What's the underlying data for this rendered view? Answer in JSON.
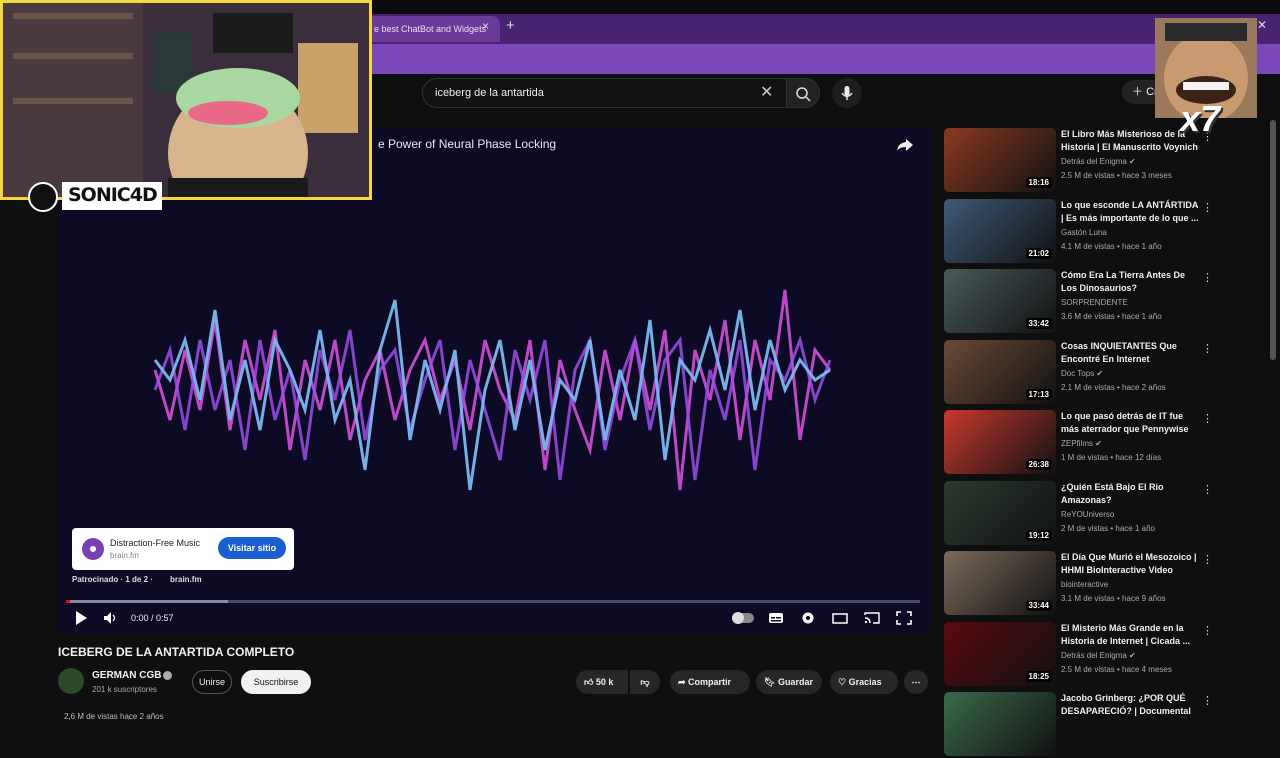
{
  "browser": {
    "active_tab_title": "e best ChatBot and Widgets",
    "close_glyph": "×",
    "new_tab_glyph": "+"
  },
  "header": {
    "search_value": "iceberg de la antartida",
    "create_label": "Cr"
  },
  "player": {
    "overlay_title": "e Power of Neural Phase Locking",
    "progress_played_fraction": 0.0,
    "progress_buffered_fraction": 0.19,
    "time": "0:00 / 0:57",
    "ad": {
      "title": "Distraction-Free Music",
      "domain": "brain.fm",
      "cta": "Visitar sitio",
      "sponsored": "Patrocinado · 1 de 2 ·",
      "sponsored_domain": "brain.fm"
    }
  },
  "video": {
    "title": "ICEBERG DE LA ANTARTIDA COMPLETO",
    "channel": "GERMAN CGB",
    "subscribers": "201 k suscriptores",
    "join_label": "Unirse",
    "subscribe_label": "Suscribirse",
    "likes": "50 k",
    "share_label": "Compartir",
    "save_label": "Guardar",
    "thanks_label": "Gracias",
    "views_partial": "2,6 M de vistas  hace 2 años"
  },
  "recommendations": [
    {
      "title": "El Libro Más Misterioso de la Historia | El Manuscrito Voynich",
      "channel": "Detrás del Enigma",
      "meta": "2.5 M de vistas • hace 3 meses",
      "duration": "18:16",
      "thumb": "#8a3a20",
      "verified": true
    },
    {
      "title": "Lo que esconde LA ANTÁRTIDA | Es más importante de lo que ...",
      "channel": "Gastón Luna",
      "meta": "4.1 M de vistas • hace 1 año",
      "duration": "21:02",
      "thumb": "#3e5a78",
      "verified": false
    },
    {
      "title": "Cómo Era La Tierra Antes De Los Dinosaurios?",
      "channel": "SORPRENDENTE",
      "meta": "3.6 M de vistas • hace 1 año",
      "duration": "33:42",
      "thumb": "#4a5a5c",
      "verified": false
    },
    {
      "title": "Cosas INQUIETANTES Que Encontré En Internet",
      "channel": "Doc Tops",
      "meta": "2.1 M de vistas • hace 2 años",
      "duration": "17:13",
      "thumb": "#6a4a36",
      "verified": true
    },
    {
      "title": "Lo que pasó detrás de IT fue más aterrador que Pennywise",
      "channel": "ZEPfilms",
      "meta": "1 M de vistas • hace 12 días",
      "duration": "26:38",
      "thumb": "#c8382e",
      "verified": true
    },
    {
      "title": "¿Quién Está Bajo El Rio Amazonas?",
      "channel": "ReYOUniverso",
      "meta": "2 M de vistas • hace 1 año",
      "duration": "19:12",
      "thumb": "#2a3a30",
      "verified": false
    },
    {
      "title": "El Día Que Murió el Mesozoico | HHMI BioInteractive Video",
      "channel": "biointeractive",
      "meta": "3.1 M de vistas • hace 9 años",
      "duration": "33:44",
      "thumb": "#7a6a5a",
      "verified": false
    },
    {
      "title": "El Misterio Más Grande en la Historia de Internet | Cicada ...",
      "channel": "Detrás del Enigma",
      "meta": "2.5 M de vistas • hace 4 meses",
      "duration": "18:25",
      "thumb": "#5a0a10",
      "verified": true
    },
    {
      "title": "Jacobo Grinberg: ¿POR QUÉ DESAPARECIÓ? | Documental",
      "channel": "",
      "meta": "",
      "duration": "",
      "thumb": "#3a6a4a",
      "verified": false
    }
  ],
  "overlays": {
    "streamer_name": "SONIC4D",
    "multiplier": "x7"
  },
  "colors": {
    "brand_red": "#ff0000",
    "tab_purple": "#4a2370",
    "wave_blue": "#7ab8f0",
    "wave_pink": "#d050d8",
    "wave_violet": "#9a50e8",
    "ad_button": "#1a5fd1"
  }
}
